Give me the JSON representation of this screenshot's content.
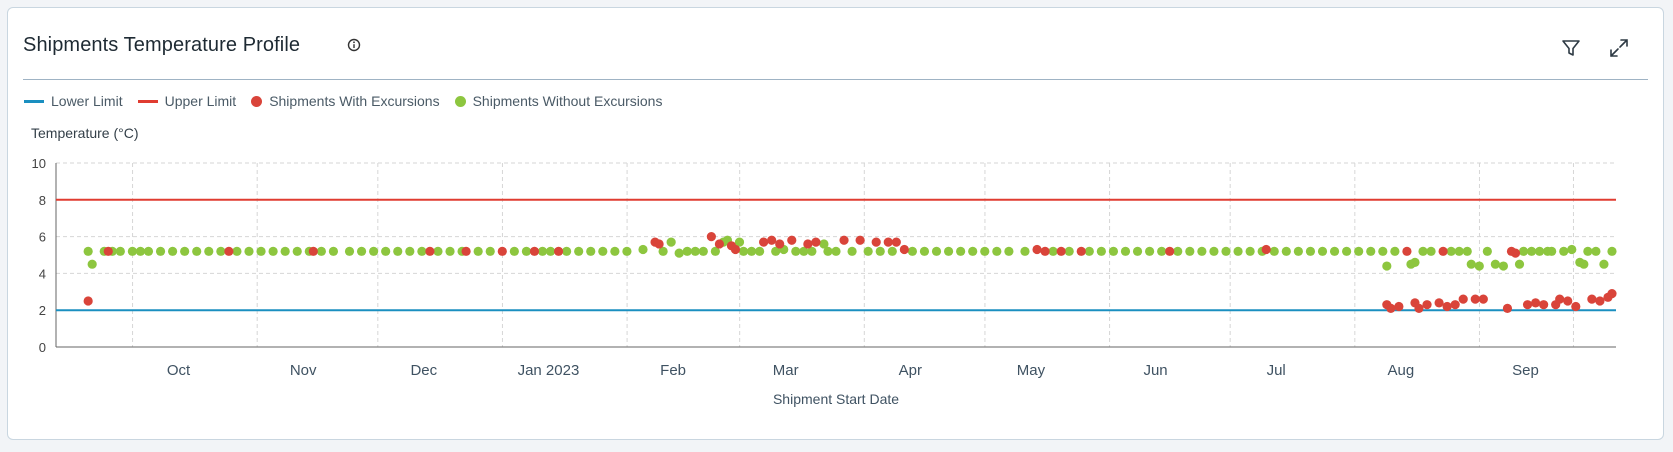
{
  "panel": {
    "title": "Shipments Temperature Profile",
    "info_icon": "info-icon",
    "filter_icon": "filter-icon",
    "expand_icon": "expand-icon"
  },
  "colors": {
    "lower": "#1a8fc0",
    "upper": "#e03c31",
    "with": "#d9443a",
    "without": "#8dc63f"
  },
  "chart_data": {
    "type": "scatter",
    "xlabel": "Shipment Start Date",
    "ylabel": "Temperature (°C)",
    "ylim": [
      0,
      10
    ],
    "yticks": [
      0,
      2,
      4,
      6,
      8,
      10
    ],
    "xlim": [
      "2022-09-04",
      "2023-09-27"
    ],
    "xticks": [
      {
        "date": "2022-10-01",
        "label": "Oct"
      },
      {
        "date": "2022-11-01",
        "label": "Nov"
      },
      {
        "date": "2022-12-01",
        "label": "Dec"
      },
      {
        "date": "2023-01-01",
        "label": "Jan 2023"
      },
      {
        "date": "2023-02-01",
        "label": "Feb"
      },
      {
        "date": "2023-03-01",
        "label": "Mar"
      },
      {
        "date": "2023-04-01",
        "label": "Apr"
      },
      {
        "date": "2023-05-01",
        "label": "May"
      },
      {
        "date": "2023-06-01",
        "label": "Jun"
      },
      {
        "date": "2023-07-01",
        "label": "Jul"
      },
      {
        "date": "2023-08-01",
        "label": "Aug"
      },
      {
        "date": "2023-09-01",
        "label": "Sep"
      }
    ],
    "grid": true,
    "legend_position": "top-left",
    "legend": [
      "Lower Limit",
      "Upper Limit",
      "Shipments With Excursions",
      "Shipments Without Excursions"
    ],
    "series": [
      {
        "name": "Lower Limit",
        "type": "line",
        "value": 2
      },
      {
        "name": "Upper Limit",
        "type": "line",
        "value": 8
      },
      {
        "name": "Shipments With Excursions",
        "type": "scatter",
        "points": [
          [
            "2022-09-12",
            2.5
          ],
          [
            "2022-09-17",
            5.2
          ],
          [
            "2022-10-17",
            5.2
          ],
          [
            "2022-11-07",
            5.2
          ],
          [
            "2022-12-06",
            5.2
          ],
          [
            "2022-12-15",
            5.2
          ],
          [
            "2022-12-24",
            5.2
          ],
          [
            "2023-01-01",
            5.2
          ],
          [
            "2023-01-07",
            5.2
          ],
          [
            "2023-01-31",
            5.7
          ],
          [
            "2023-02-01",
            5.6
          ],
          [
            "2023-02-14",
            6.0
          ],
          [
            "2023-02-16",
            5.6
          ],
          [
            "2023-02-19",
            5.5
          ],
          [
            "2023-02-20",
            5.3
          ],
          [
            "2023-02-27",
            5.7
          ],
          [
            "2023-03-01",
            5.8
          ],
          [
            "2023-03-03",
            5.6
          ],
          [
            "2023-03-06",
            5.8
          ],
          [
            "2023-03-10",
            5.6
          ],
          [
            "2023-03-12",
            5.7
          ],
          [
            "2023-03-19",
            5.8
          ],
          [
            "2023-03-23",
            5.8
          ],
          [
            "2023-03-27",
            5.7
          ],
          [
            "2023-03-30",
            5.7
          ],
          [
            "2023-04-01",
            5.7
          ],
          [
            "2023-04-03",
            5.3
          ],
          [
            "2023-05-06",
            5.3
          ],
          [
            "2023-05-08",
            5.2
          ],
          [
            "2023-05-12",
            5.2
          ],
          [
            "2023-05-17",
            5.2
          ],
          [
            "2023-06-08",
            5.2
          ],
          [
            "2023-07-02",
            5.3
          ],
          [
            "2023-08-01",
            2.3
          ],
          [
            "2023-08-02",
            2.1
          ],
          [
            "2023-08-04",
            2.2
          ],
          [
            "2023-08-06",
            5.2
          ],
          [
            "2023-08-08",
            2.4
          ],
          [
            "2023-08-09",
            2.1
          ],
          [
            "2023-08-11",
            2.3
          ],
          [
            "2023-08-14",
            2.4
          ],
          [
            "2023-08-15",
            5.2
          ],
          [
            "2023-08-16",
            2.2
          ],
          [
            "2023-08-18",
            2.3
          ],
          [
            "2023-08-20",
            2.6
          ],
          [
            "2023-08-23",
            2.6
          ],
          [
            "2023-08-25",
            2.6
          ],
          [
            "2023-08-31",
            2.1
          ],
          [
            "2023-09-01",
            5.2
          ],
          [
            "2023-09-02",
            5.1
          ],
          [
            "2023-09-05",
            2.3
          ],
          [
            "2023-09-07",
            2.4
          ],
          [
            "2023-09-09",
            2.3
          ],
          [
            "2023-09-12",
            2.3
          ],
          [
            "2023-09-13",
            2.6
          ],
          [
            "2023-09-15",
            2.5
          ],
          [
            "2023-09-17",
            2.2
          ],
          [
            "2023-09-21",
            2.6
          ],
          [
            "2023-09-23",
            2.5
          ],
          [
            "2023-09-25",
            2.7
          ],
          [
            "2023-09-26",
            2.9
          ]
        ]
      },
      {
        "name": "Shipments Without Excursions",
        "type": "scatter",
        "points": [
          [
            "2022-09-12",
            5.2
          ],
          [
            "2022-09-13",
            4.5
          ],
          [
            "2022-09-16",
            5.2
          ],
          [
            "2022-09-18",
            5.2
          ],
          [
            "2022-09-20",
            5.2
          ],
          [
            "2022-09-23",
            5.2
          ],
          [
            "2022-09-25",
            5.2
          ],
          [
            "2022-09-27",
            5.2
          ],
          [
            "2022-09-30",
            5.2
          ],
          [
            "2022-10-03",
            5.2
          ],
          [
            "2022-10-06",
            5.2
          ],
          [
            "2022-10-09",
            5.2
          ],
          [
            "2022-10-12",
            5.2
          ],
          [
            "2022-10-15",
            5.2
          ],
          [
            "2022-10-19",
            5.2
          ],
          [
            "2022-10-22",
            5.2
          ],
          [
            "2022-10-25",
            5.2
          ],
          [
            "2022-10-28",
            5.2
          ],
          [
            "2022-10-31",
            5.2
          ],
          [
            "2022-11-03",
            5.2
          ],
          [
            "2022-11-06",
            5.2
          ],
          [
            "2022-11-09",
            5.2
          ],
          [
            "2022-11-12",
            5.2
          ],
          [
            "2022-11-16",
            5.2
          ],
          [
            "2022-11-19",
            5.2
          ],
          [
            "2022-11-22",
            5.2
          ],
          [
            "2022-11-25",
            5.2
          ],
          [
            "2022-11-28",
            5.2
          ],
          [
            "2022-12-01",
            5.2
          ],
          [
            "2022-12-04",
            5.2
          ],
          [
            "2022-12-08",
            5.2
          ],
          [
            "2022-12-11",
            5.2
          ],
          [
            "2022-12-14",
            5.2
          ],
          [
            "2022-12-18",
            5.2
          ],
          [
            "2022-12-21",
            5.2
          ],
          [
            "2022-12-27",
            5.2
          ],
          [
            "2022-12-30",
            5.2
          ],
          [
            "2023-01-03",
            5.2
          ],
          [
            "2023-01-05",
            5.2
          ],
          [
            "2023-01-09",
            5.2
          ],
          [
            "2023-01-12",
            5.2
          ],
          [
            "2023-01-15",
            5.2
          ],
          [
            "2023-01-18",
            5.2
          ],
          [
            "2023-01-21",
            5.2
          ],
          [
            "2023-01-24",
            5.2
          ],
          [
            "2023-01-28",
            5.3
          ],
          [
            "2023-02-02",
            5.2
          ],
          [
            "2023-02-04",
            5.7
          ],
          [
            "2023-02-06",
            5.1
          ],
          [
            "2023-02-08",
            5.2
          ],
          [
            "2023-02-10",
            5.2
          ],
          [
            "2023-02-12",
            5.2
          ],
          [
            "2023-02-15",
            5.2
          ],
          [
            "2023-02-17",
            5.7
          ],
          [
            "2023-02-18",
            5.8
          ],
          [
            "2023-02-21",
            5.7
          ],
          [
            "2023-02-22",
            5.2
          ],
          [
            "2023-02-24",
            5.2
          ],
          [
            "2023-02-26",
            5.2
          ],
          [
            "2023-03-02",
            5.2
          ],
          [
            "2023-03-04",
            5.3
          ],
          [
            "2023-03-07",
            5.2
          ],
          [
            "2023-03-09",
            5.2
          ],
          [
            "2023-03-11",
            5.2
          ],
          [
            "2023-03-14",
            5.6
          ],
          [
            "2023-03-15",
            5.2
          ],
          [
            "2023-03-17",
            5.2
          ],
          [
            "2023-03-21",
            5.2
          ],
          [
            "2023-03-25",
            5.2
          ],
          [
            "2023-03-28",
            5.2
          ],
          [
            "2023-03-31",
            5.2
          ],
          [
            "2023-04-05",
            5.2
          ],
          [
            "2023-04-08",
            5.2
          ],
          [
            "2023-04-11",
            5.2
          ],
          [
            "2023-04-14",
            5.2
          ],
          [
            "2023-04-17",
            5.2
          ],
          [
            "2023-04-20",
            5.2
          ],
          [
            "2023-04-23",
            5.2
          ],
          [
            "2023-04-26",
            5.2
          ],
          [
            "2023-04-29",
            5.2
          ],
          [
            "2023-05-03",
            5.2
          ],
          [
            "2023-05-10",
            5.2
          ],
          [
            "2023-05-14",
            5.2
          ],
          [
            "2023-05-19",
            5.2
          ],
          [
            "2023-05-22",
            5.2
          ],
          [
            "2023-05-25",
            5.2
          ],
          [
            "2023-05-28",
            5.2
          ],
          [
            "2023-05-31",
            5.2
          ],
          [
            "2023-06-03",
            5.2
          ],
          [
            "2023-06-06",
            5.2
          ],
          [
            "2023-06-10",
            5.2
          ],
          [
            "2023-06-13",
            5.2
          ],
          [
            "2023-06-16",
            5.2
          ],
          [
            "2023-06-19",
            5.2
          ],
          [
            "2023-06-22",
            5.2
          ],
          [
            "2023-06-25",
            5.2
          ],
          [
            "2023-06-28",
            5.2
          ],
          [
            "2023-07-01",
            5.2
          ],
          [
            "2023-07-04",
            5.2
          ],
          [
            "2023-07-07",
            5.2
          ],
          [
            "2023-07-10",
            5.2
          ],
          [
            "2023-07-13",
            5.2
          ],
          [
            "2023-07-16",
            5.2
          ],
          [
            "2023-07-19",
            5.2
          ],
          [
            "2023-07-22",
            5.2
          ],
          [
            "2023-07-25",
            5.2
          ],
          [
            "2023-07-28",
            5.2
          ],
          [
            "2023-07-31",
            5.2
          ],
          [
            "2023-08-01",
            4.4
          ],
          [
            "2023-08-03",
            5.2
          ],
          [
            "2023-08-07",
            4.5
          ],
          [
            "2023-08-08",
            4.6
          ],
          [
            "2023-08-10",
            5.2
          ],
          [
            "2023-08-12",
            5.2
          ],
          [
            "2023-08-17",
            5.2
          ],
          [
            "2023-08-19",
            5.2
          ],
          [
            "2023-08-21",
            5.2
          ],
          [
            "2023-08-22",
            4.5
          ],
          [
            "2023-08-24",
            4.4
          ],
          [
            "2023-08-26",
            5.2
          ],
          [
            "2023-08-28",
            4.5
          ],
          [
            "2023-08-30",
            4.4
          ],
          [
            "2023-09-03",
            4.5
          ],
          [
            "2023-09-04",
            5.2
          ],
          [
            "2023-09-06",
            5.2
          ],
          [
            "2023-09-08",
            5.2
          ],
          [
            "2023-09-10",
            5.2
          ],
          [
            "2023-09-11",
            5.2
          ],
          [
            "2023-09-14",
            5.2
          ],
          [
            "2023-09-16",
            5.3
          ],
          [
            "2023-09-18",
            4.6
          ],
          [
            "2023-09-19",
            4.5
          ],
          [
            "2023-09-20",
            5.2
          ],
          [
            "2023-09-22",
            5.2
          ],
          [
            "2023-09-24",
            4.5
          ],
          [
            "2023-09-26",
            5.2
          ]
        ]
      }
    ]
  }
}
